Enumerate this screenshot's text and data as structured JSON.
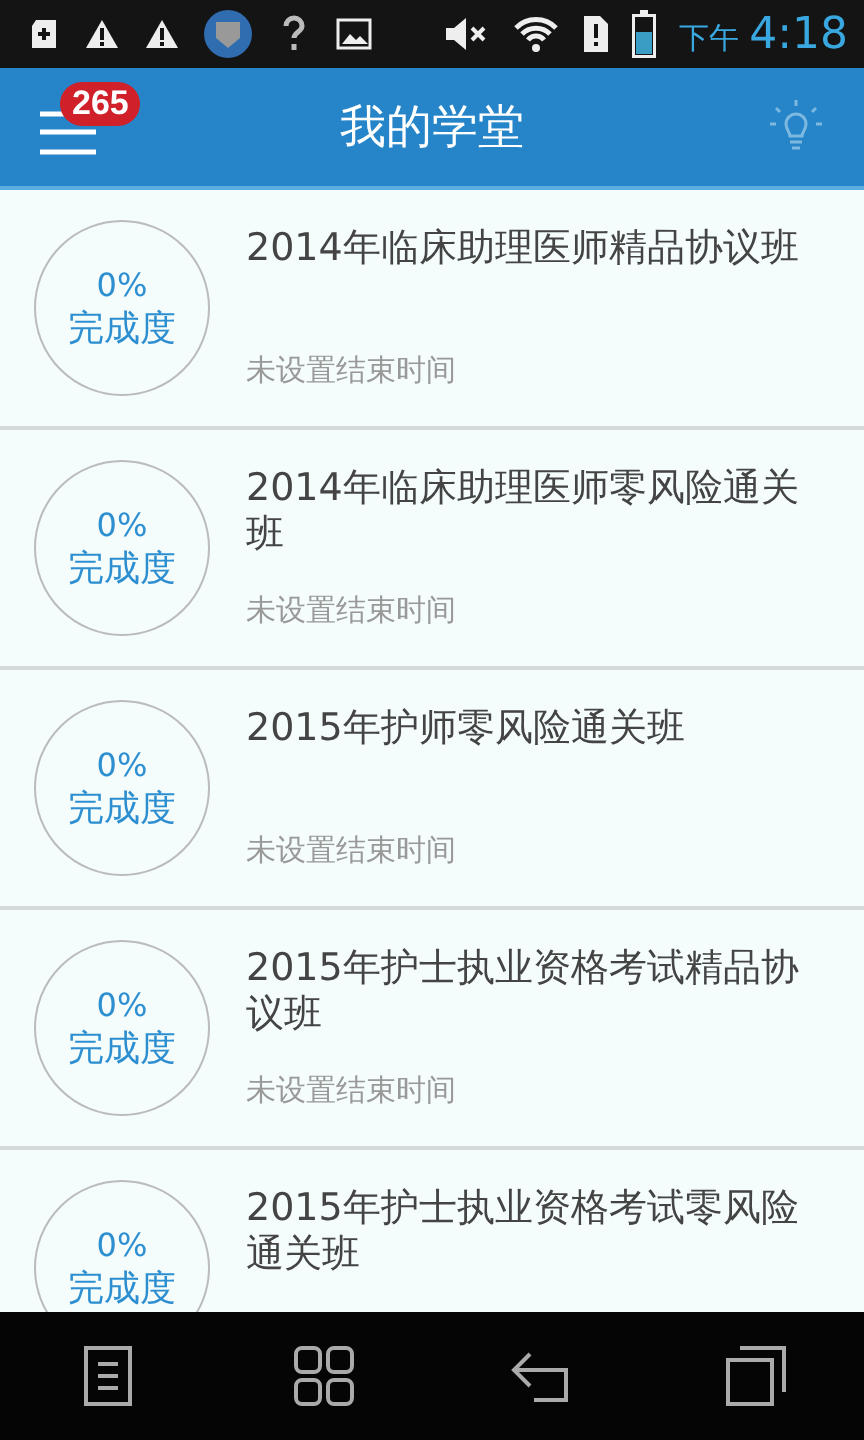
{
  "status_bar": {
    "period": "下午",
    "time": "4:18"
  },
  "header": {
    "title": "我的学堂",
    "badge": "265"
  },
  "courses": [
    {
      "progress": "0%",
      "progress_label": "完成度",
      "title": "2014年临床助理医师精品协议班",
      "end_time": "未设置结束时间"
    },
    {
      "progress": "0%",
      "progress_label": "完成度",
      "title": "2014年临床助理医师零风险通关班",
      "end_time": "未设置结束时间"
    },
    {
      "progress": "0%",
      "progress_label": "完成度",
      "title": "2015年护师零风险通关班",
      "end_time": "未设置结束时间"
    },
    {
      "progress": "0%",
      "progress_label": "完成度",
      "title": "2015年护士执业资格考试精品协议班",
      "end_time": "未设置结束时间"
    },
    {
      "progress": "0%",
      "progress_label": "完成度",
      "title": "2015年护士执业资格考试零风险通关班"
    }
  ]
}
